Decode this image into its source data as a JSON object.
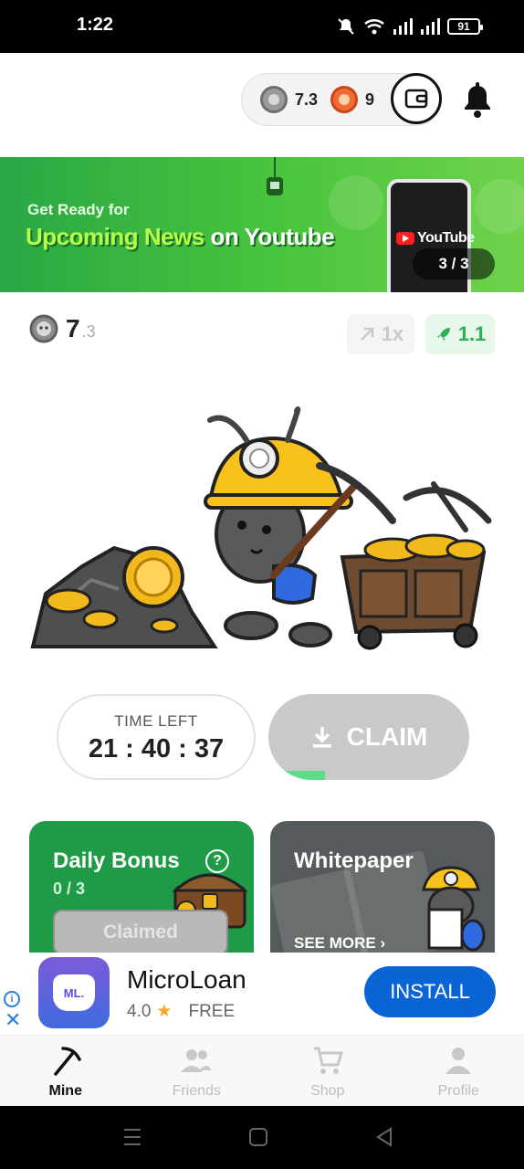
{
  "status_bar": {
    "time": "1:22",
    "battery": "91"
  },
  "header": {
    "silver_balance": "7.3",
    "orange_balance": "9"
  },
  "banner": {
    "pre_title": "Get Ready for",
    "headline_accent": "Upcoming News",
    "headline_rest": "on Youtube",
    "phone_brand": "YouTube",
    "pager": "3 / 3"
  },
  "mining": {
    "balance_main": "7",
    "balance_decimal": ".3",
    "boost": "1x",
    "speed": "1.1"
  },
  "timer": {
    "label": "TIME LEFT",
    "value": "21 : 40 : 37"
  },
  "claim": {
    "label": "CLAIM",
    "progress": 0.28
  },
  "cards": {
    "daily_bonus": {
      "title": "Daily Bonus",
      "progress": "0 / 3",
      "button": "Claimed"
    },
    "whitepaper": {
      "title": "Whitepaper",
      "link": "SEE MORE ›"
    }
  },
  "ad": {
    "icon_text": "ML.",
    "name": "MicroLoan",
    "rating": "4.0",
    "price": "FREE",
    "install": "INSTALL"
  },
  "nav": {
    "items": [
      {
        "label": "Mine",
        "icon": "pickaxe-icon",
        "active": true
      },
      {
        "label": "Friends",
        "icon": "friends-icon",
        "active": false
      },
      {
        "label": "Shop",
        "icon": "cart-icon",
        "active": false
      },
      {
        "label": "Profile",
        "icon": "person-icon",
        "active": false
      }
    ]
  },
  "colors": {
    "banner_green": "#47c33d",
    "speed_green": "#2bb155",
    "bonus_green": "#1f9a46",
    "install_blue": "#0a64d6",
    "claim_gray": "#c9c9c9"
  }
}
